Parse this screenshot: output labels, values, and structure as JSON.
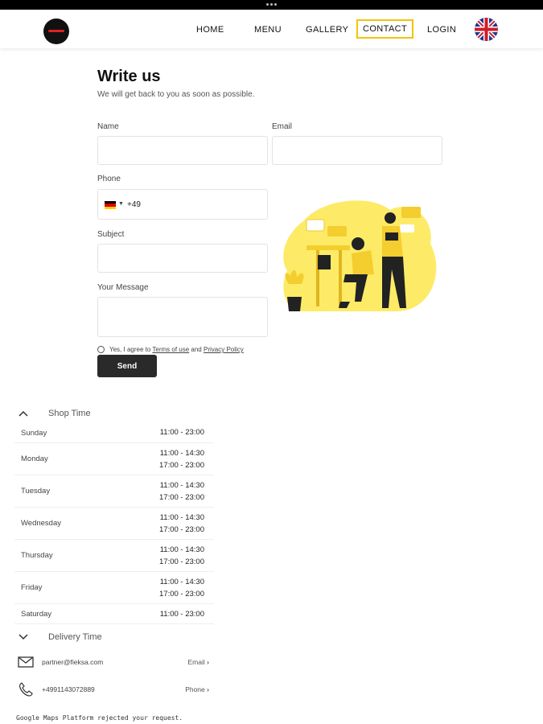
{
  "nav": {
    "items": [
      "HOME",
      "MENU",
      "GALLERY",
      "CONTACT",
      "LOGIN"
    ],
    "active": "CONTACT"
  },
  "form": {
    "title": "Write us",
    "subtitle": "We will get back to you as soon as possible.",
    "name_label": "Name",
    "name_value": "",
    "email_label": "Email",
    "email_value": "",
    "phone_label": "Phone",
    "phone_code": "+49",
    "subject_label": "Subject",
    "subject_value": "",
    "message_label": "Your Message",
    "message_value": "",
    "agree_prefix": "Yes, I agree to",
    "terms_link": "Terms of use",
    "agree_and": "and",
    "privacy_link": "Privacy Policy",
    "send_label": "Send"
  },
  "shop_time": {
    "title": "Shop Time",
    "rows": [
      {
        "day": "Sunday",
        "times": [
          "11:00 - 23:00"
        ]
      },
      {
        "day": "Monday",
        "times": [
          "11:00 - 14:30",
          "17:00 - 23:00"
        ]
      },
      {
        "day": "Tuesday",
        "times": [
          "11:00 - 14:30",
          "17:00 - 23:00"
        ]
      },
      {
        "day": "Wednesday",
        "times": [
          "11:00 - 14:30",
          "17:00 - 23:00"
        ]
      },
      {
        "day": "Thursday",
        "times": [
          "11:00 - 14:30",
          "17:00 - 23:00"
        ]
      },
      {
        "day": "Friday",
        "times": [
          "11:00 - 14:30",
          "17:00 - 23:00"
        ]
      },
      {
        "day": "Saturday",
        "times": [
          "11:00 - 23:00"
        ]
      }
    ]
  },
  "delivery_time": {
    "title": "Delivery Time"
  },
  "contact": {
    "email": "partner@fieksa.com",
    "email_link": "Email",
    "phone": "+4991143072889",
    "phone_link": "Phone"
  },
  "map_message": "Google Maps Platform rejected your request.",
  "colors": {
    "accent": "#f2c40b",
    "button": "#2a2a2a",
    "illustration": "#fde74c"
  }
}
